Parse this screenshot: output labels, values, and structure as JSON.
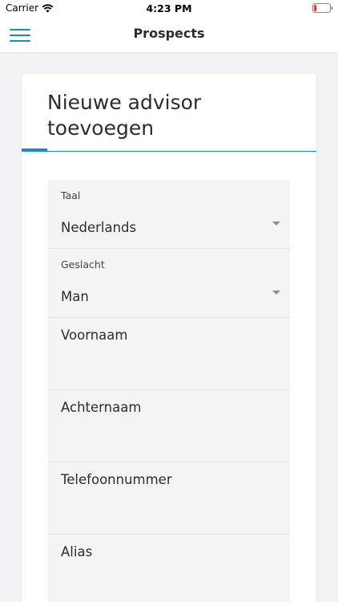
{
  "status_bar": {
    "carrier": "Carrier",
    "time": "4:23 PM",
    "battery_color": "#e53935"
  },
  "nav": {
    "title": "Prospects",
    "accent_color": "#1a8bc8"
  },
  "card": {
    "title": "Nieuwe advisor toevoegen"
  },
  "form": {
    "language": {
      "label": "Taal",
      "value": "Nederlands"
    },
    "gender": {
      "label": "Geslacht",
      "value": "Man"
    },
    "first_name": {
      "placeholder": "Voornaam"
    },
    "last_name": {
      "placeholder": "Achternaam"
    },
    "phone": {
      "placeholder": "Telefoonnummer"
    },
    "alias": {
      "placeholder": "Alias"
    }
  }
}
